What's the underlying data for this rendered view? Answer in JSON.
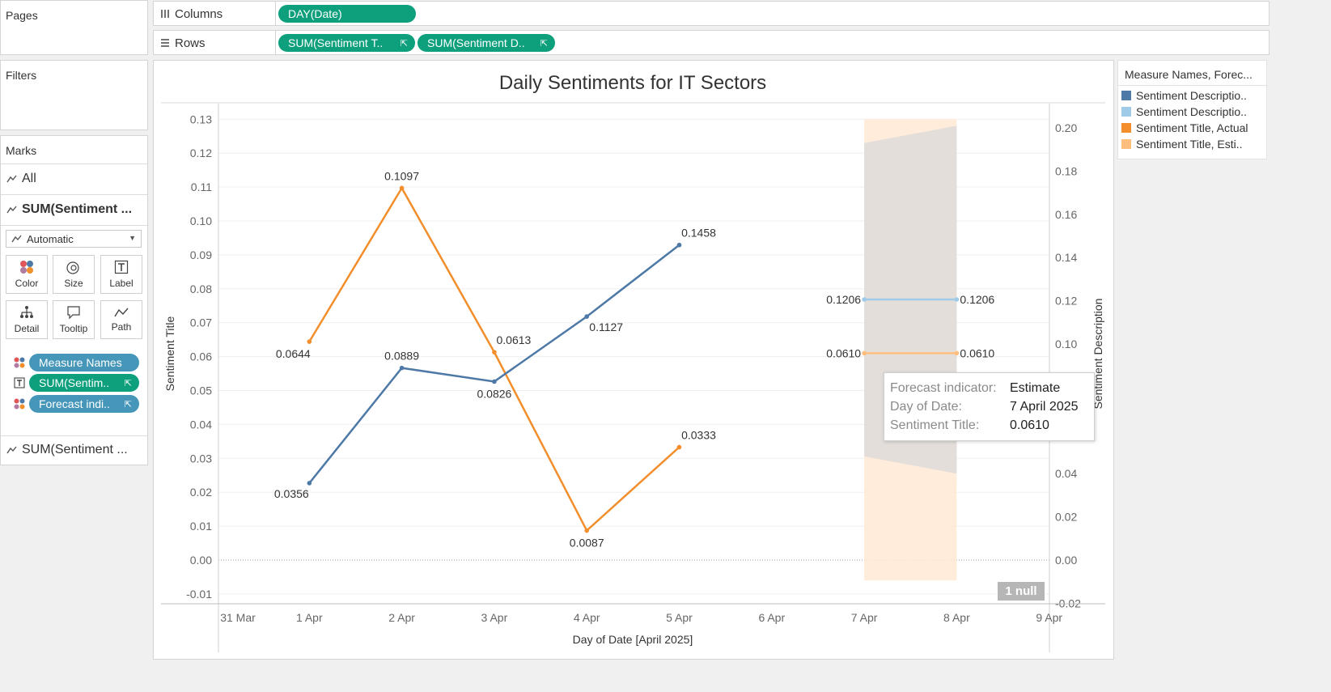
{
  "pages": {
    "title": "Pages"
  },
  "filters": {
    "title": "Filters"
  },
  "shelves": {
    "columns": {
      "label": "Columns",
      "pills": [
        "DAY(Date)"
      ]
    },
    "rows": {
      "label": "Rows",
      "pills": [
        "SUM(Sentiment T..",
        "SUM(Sentiment D.."
      ]
    }
  },
  "marks": {
    "title": "Marks",
    "all_label": "All",
    "card1_label": "SUM(Sentiment ...",
    "card2_label": "SUM(Sentiment ...",
    "mark_type": "Automatic",
    "buttons": [
      "Color",
      "Size",
      "Label",
      "Detail",
      "Tooltip",
      "Path"
    ],
    "pills": [
      "Measure Names",
      "SUM(Sentim..",
      "Forecast indi.."
    ]
  },
  "legend": {
    "title": "Measure Names, Forec...",
    "items": [
      {
        "label": "Sentiment Descriptio..",
        "color": "#4e79a7"
      },
      {
        "label": "Sentiment Descriptio..",
        "color": "#a0cbe8"
      },
      {
        "label": "Sentiment Title, Actual",
        "color": "#f28e2b"
      },
      {
        "label": "Sentiment Title, Esti..",
        "color": "#ffbe7d"
      }
    ]
  },
  "null_badge": "1 null",
  "tooltip": {
    "rows": [
      {
        "key": "Forecast indicator:",
        "value": "Estimate"
      },
      {
        "key": "Day of Date:",
        "value": "7 April 2025"
      },
      {
        "key": "Sentiment Title:",
        "value": "0.0610"
      }
    ]
  },
  "chart_data": {
    "type": "line",
    "title": "Daily Sentiments for IT Sectors",
    "xlabel": "Day of Date [April 2025]",
    "ylabel_left": "Sentiment Title",
    "ylabel_right": "Sentiment Description",
    "x_ticks": [
      "31 Mar",
      "1 Apr",
      "2 Apr",
      "3 Apr",
      "4 Apr",
      "5 Apr",
      "6 Apr",
      "7 Apr",
      "8 Apr",
      "9 Apr"
    ],
    "ylim_left": [
      -0.01,
      0.13
    ],
    "yticks_left": [
      "0.13",
      "0.12",
      "0.11",
      "0.10",
      "0.09",
      "0.08",
      "0.07",
      "0.06",
      "0.05",
      "0.04",
      "0.03",
      "0.02",
      "0.01",
      "0.00",
      "-0.01"
    ],
    "ylim_right": [
      -0.02,
      0.2
    ],
    "yticks_right": [
      "0.20",
      "0.18",
      "0.16",
      "0.14",
      "0.12",
      "0.10",
      "0.04",
      "0.02",
      "0.00",
      "-0.02"
    ],
    "series": [
      {
        "name": "Sentiment Title, Actual",
        "axis": "left",
        "color": "#f28e2b",
        "x": [
          "1 Apr",
          "2 Apr",
          "3 Apr",
          "4 Apr",
          "5 Apr"
        ],
        "values": [
          0.0644,
          0.1097,
          0.0613,
          0.0087,
          0.0333
        ],
        "labels": [
          "0.0644",
          "0.1097",
          "0.0613",
          "0.0087",
          "0.0333"
        ]
      },
      {
        "name": "Sentiment Description, Actual",
        "axis": "right",
        "color": "#4e79a7",
        "x": [
          "1 Apr",
          "2 Apr",
          "3 Apr",
          "4 Apr",
          "5 Apr"
        ],
        "values": [
          0.0356,
          0.0889,
          0.0826,
          0.1127,
          0.1458
        ],
        "labels": [
          "0.0356",
          "0.0889",
          "0.0826",
          "0.1127",
          "0.1458"
        ]
      },
      {
        "name": "Sentiment Title, Estimate",
        "axis": "left",
        "color": "#ffbe7d",
        "x": [
          "7 Apr",
          "8 Apr"
        ],
        "values": [
          0.061,
          0.061
        ],
        "labels": [
          "0.0610",
          "0.0610"
        ],
        "band": {
          "upper": [
            0.13,
            0.13
          ],
          "lower": [
            -0.006,
            -0.006
          ]
        }
      },
      {
        "name": "Sentiment Description, Estimate",
        "axis": "right",
        "color": "#a0cbe8",
        "x": [
          "7 Apr",
          "8 Apr"
        ],
        "values": [
          0.1206,
          0.1206
        ],
        "labels": [
          "0.1206",
          "0.1206"
        ],
        "band": {
          "upper": [
            0.193,
            0.201
          ],
          "lower": [
            0.048,
            0.04
          ]
        }
      }
    ],
    "grid": true
  }
}
